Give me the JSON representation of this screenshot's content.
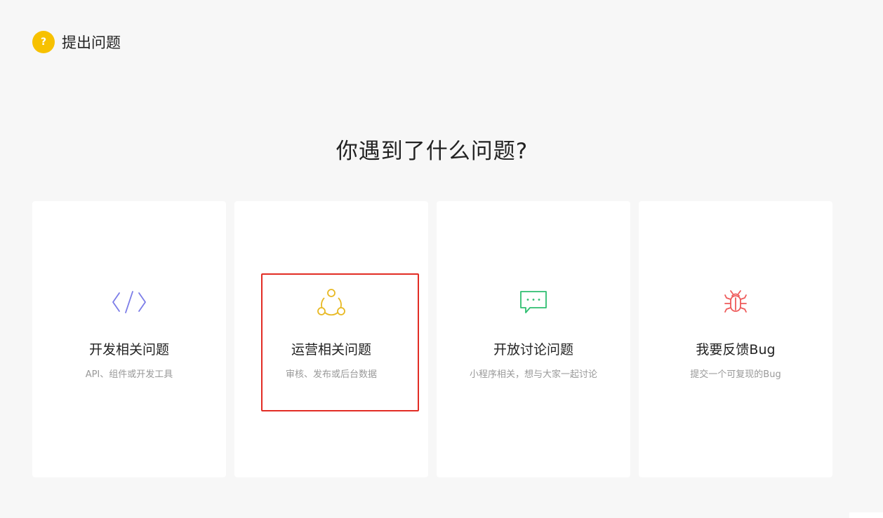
{
  "header": {
    "badge": "?",
    "title": "提出问题"
  },
  "main": {
    "question": "你遇到了什么问题?"
  },
  "cards": [
    {
      "icon": "code-icon",
      "color": "#7b7ce8",
      "title": "开发相关问题",
      "desc": "API、组件或开发工具"
    },
    {
      "icon": "share-circle-icon",
      "color": "#e8b923",
      "title": "运营相关问题",
      "desc": "审核、发布或后台数据"
    },
    {
      "icon": "chat-bubble-icon",
      "color": "#2fbf71",
      "title": "开放讨论问题",
      "desc": "小程序相关，想与大家一起讨论"
    },
    {
      "icon": "bug-icon",
      "color": "#ee5a5a",
      "title": "我要反馈Bug",
      "desc": "提交一个可复现的Bug"
    }
  ]
}
